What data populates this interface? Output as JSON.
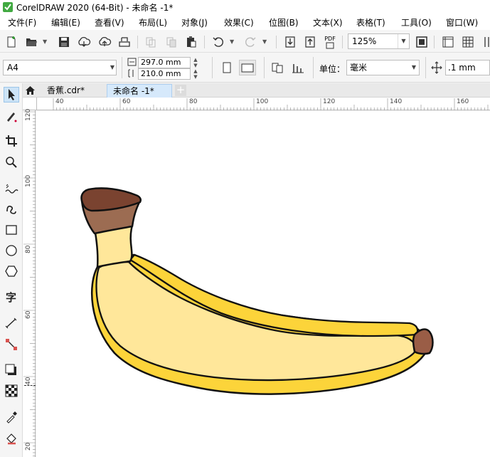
{
  "window": {
    "title": "CorelDRAW 2020 (64-Bit) - 未命名 -1*"
  },
  "menu": [
    "文件(F)",
    "编辑(E)",
    "查看(V)",
    "布局(L)",
    "对象(J)",
    "效果(C)",
    "位图(B)",
    "文本(X)",
    "表格(T)",
    "工具(O)",
    "窗口(W)"
  ],
  "toolbar": {
    "pdf_label": "PDF",
    "zoom_value": "125%"
  },
  "property_bar": {
    "page_size": "A4",
    "width": "297.0 mm",
    "height": "210.0 mm",
    "unit_label": "单位：",
    "unit_value": "毫米",
    "nudge": ".1 mm"
  },
  "tabs": [
    {
      "label": "香蕉.cdr*",
      "active": false
    },
    {
      "label": "未命名 -1*",
      "active": true
    }
  ],
  "rulers": {
    "horizontal": [
      "40",
      "60",
      "80",
      "100",
      "120",
      "140",
      "160"
    ],
    "vertical": [
      "120",
      "100",
      "80",
      "60",
      "40",
      "20"
    ]
  },
  "colors": {
    "banana_outer": "#fcd43a",
    "banana_inner": "#ffe79a",
    "stem_top": "#7a4330",
    "stem_bottom": "#9c6c52",
    "tip": "#9a5d46",
    "outline": "#111111"
  },
  "icons": [
    "new-document-icon",
    "open-folder-icon",
    "save-icon",
    "cloud-import-icon",
    "cloud-export-icon",
    "print-icon",
    "undo-icon",
    "redo-icon",
    "import-icon",
    "export-icon",
    "publish-pdf-icon",
    "full-screen-icon",
    "rulers-icon",
    "grid-icon",
    "pick-tool-icon",
    "freehand-tool-icon",
    "crop-tool-icon",
    "zoom-tool-icon",
    "artistic-media-icon",
    "smart-drawing-icon",
    "rectangle-tool-icon",
    "ellipse-tool-icon",
    "polygon-tool-icon",
    "text-tool-icon",
    "parallel-dimension-icon",
    "connector-tool-icon",
    "drop-shadow-icon",
    "transparency-icon",
    "eyedropper-icon",
    "interactive-fill-icon"
  ]
}
